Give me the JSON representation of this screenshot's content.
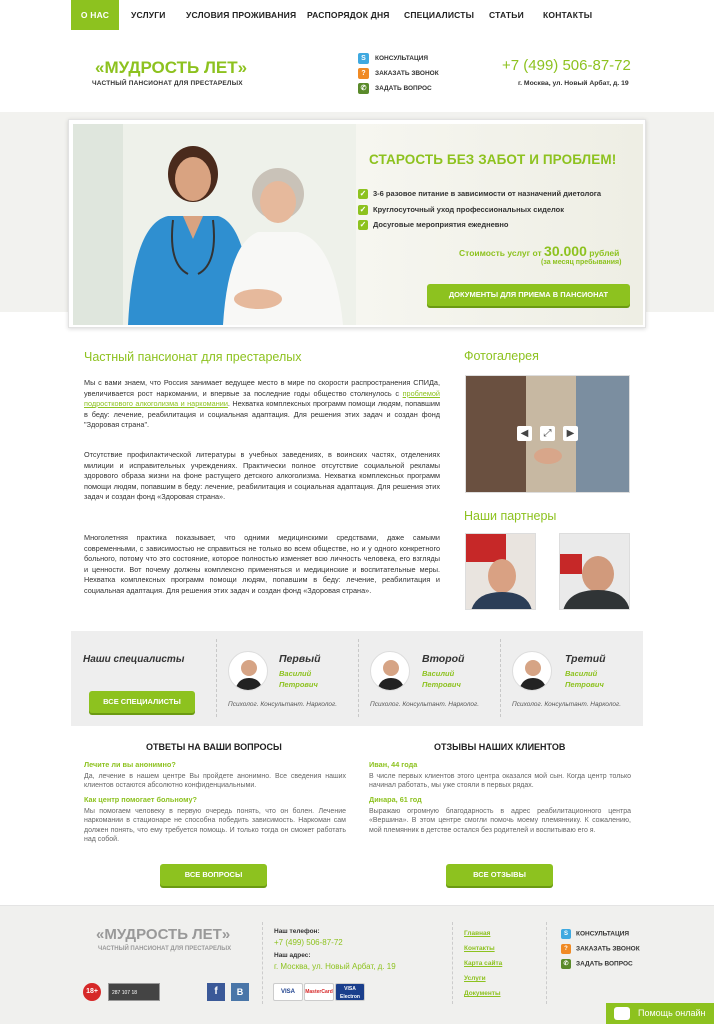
{
  "nav": {
    "items": [
      "О НАС",
      "УСЛУГИ",
      "УСЛОВИЯ ПРОЖИВАНИЯ",
      "РАСПОРЯДОК ДНЯ",
      "СПЕЦИАЛИСТЫ",
      "СТАТЬИ",
      "КОНТАКТЫ"
    ],
    "active": "О НАС"
  },
  "header": {
    "brand": "«МУДРОСТЬ ЛЕТ»",
    "subtitle": "ЧАСТНЫЙ ПАНСИОНАТ ДЛЯ ПРЕСТАРЕЛЫХ",
    "links": [
      "КОНСУЛЬТАЦИЯ",
      "ЗАКАЗАТЬ ЗВОНОК",
      "ЗАДАТЬ ВОПРОС"
    ],
    "phone": "+7 (499) 506-87-72",
    "address": "г. Москва, ул. Новый Арбат, д. 19"
  },
  "banner": {
    "slogan": "СТАРОСТЬ БЕЗ ЗАБОТ И ПРОБЛЕМ!",
    "features": [
      "3-6 разовое питание в зависимости от назначений диетолога",
      "Круглосуточный уход профессиональных сиделок",
      "Досуговые мероприятия ежедневно"
    ],
    "price_prefix": "Стоимость услуг от",
    "price_value": "30.000",
    "price_suffix": "рублей",
    "price_note": "(за месяц пребывания)",
    "button": "ДОКУМЕНТЫ ДЛЯ ПРИЕМА В ПАНСИОНАТ"
  },
  "about": {
    "title": "Частный пансионат для престарелых",
    "p1_start": "Мы с вами знаем, что Россия занимает ведущее место в мире по скорости распространения СПИДа, увеличивается рост наркомании, и впервые за последние годы общество столкнулось с ",
    "p1_link": "проблемой подросткового алкоголизма и наркомании",
    "p1_end": ". Нехватка комплексных программ помощи людям, попавшим в беду: лечение, реабилитация и социальная адаптация. Для решения этих задач и создан фонд \"Здоровая страна\".",
    "p2": "Отсутствие профилактической литературы в учебных заведениях, в воинских частях, отделениях милиции и исправительных учреждениях. Практически полное отсутствие социальной рекламы здорового образа жизни на фоне растущего детского алкоголизма. Нехватка комплексных программ помощи людям, попавшим в беду: лечение, реабилитация и социальная адаптация. Для решения этих задач и создан фонд «Здоровая страна».",
    "p3": "Многолетняя практика показывает, что одними медицинскими средствами, даже самыми современными, с зависимостью не справиться не только во всем обществе, но и у одного конкретного больного, потому что это состояние, которое полностью изменяет всю личность человека, его взгляды и ценности. Вот почему должны комплексно применяться и медицинские и воспитательные меры. Нехватка комплексных программ помощи людям, попавшим в беду: лечение, реабилитация и социальная адаптация. Для решения этих задач и создан фонд «Здоровая страна»."
  },
  "sidebar": {
    "gallery_title": "Фотогалерея",
    "partners_title": "Наши партнеры"
  },
  "specialists": {
    "title": "Наши специалисты",
    "button": "ВСЕ СПЕЦИАЛИСТЫ",
    "people": [
      {
        "surname": "Первый",
        "name": "Василий",
        "patronymic": "Петрович",
        "role": "Психолог. Консультант. Нарколог."
      },
      {
        "surname": "Второй",
        "name": "Василий",
        "patronymic": "Петрович",
        "role": "Психолог. Консультант. Нарколог."
      },
      {
        "surname": "Третий",
        "name": "Василий",
        "patronymic": "Петрович",
        "role": "Психолог. Консультант. Нарколог."
      }
    ]
  },
  "faq": {
    "title": "ОТВЕТЫ НА ВАШИ ВОПРОСЫ",
    "q1": "Лечите ли вы анонимно?",
    "a1": "Да, лечение в нашем центре Вы пройдете анонимно. Все сведения наших клиентов остаются абсолютно конфиденциальными.",
    "q2": "Как центр помогает больному?",
    "a2": "Мы помогаем человеку в первую очередь понять, что он болен. Лечение наркомании в стационаре не способна победить зависимость. Наркоман сам должен понять, что ему требуется помощь. И только тогда он сможет работать над собой.",
    "button": "ВСЕ ВОПРОСЫ"
  },
  "reviews": {
    "title": "ОТЗЫВЫ НАШИХ КЛИЕНТОВ",
    "n1": "Иван, 44 года",
    "t1": "В числе первых клиентов этого центра оказался мой сын. Когда центр только начинал работать, мы уже стояли в первых рядах.",
    "n2": "Динара, 61 год",
    "t2": "Выражаю огромную благодарность в адрес реабилитационного центра «Вершина». В этом центре смогли помочь моему племяннику. К сожалению, мой племянник в детстве остался без родителей и воспитываю его я.",
    "button": "ВСЕ ОТЗЫВЫ"
  },
  "footer": {
    "brand": "«МУДРОСТЬ ЛЕТ»",
    "subtitle": "ЧАСТНЫЙ ПАНСИОНАТ ДЛЯ ПРЕСТАРЕЛЫХ",
    "phone_label": "Наш телефон:",
    "phone": "+7 (499) 506-87-72",
    "addr_label": "Наш адрес:",
    "address": "г. Москва, ул. Новый Арбат, д. 19",
    "links": [
      "Главная",
      "Контакты",
      "Карта сайта",
      "Услуги",
      "Документы"
    ],
    "contacts": [
      "КОНСУЛЬТАЦИЯ",
      "ЗАКАЗАТЬ ЗВОНОК",
      "ЗАДАТЬ ВОПРОС"
    ],
    "age": "18+",
    "counter": "287 107 18",
    "social": [
      "f",
      "В"
    ],
    "cards": [
      "VISA",
      "MasterCard",
      "VISA Electron"
    ],
    "chat": "Помощь онлайн"
  },
  "colors": {
    "accent": "#8dc21f",
    "text": "#333333",
    "skype": "#3fa9e0",
    "call": "#f08a24",
    "question": "#5a8a2a"
  }
}
